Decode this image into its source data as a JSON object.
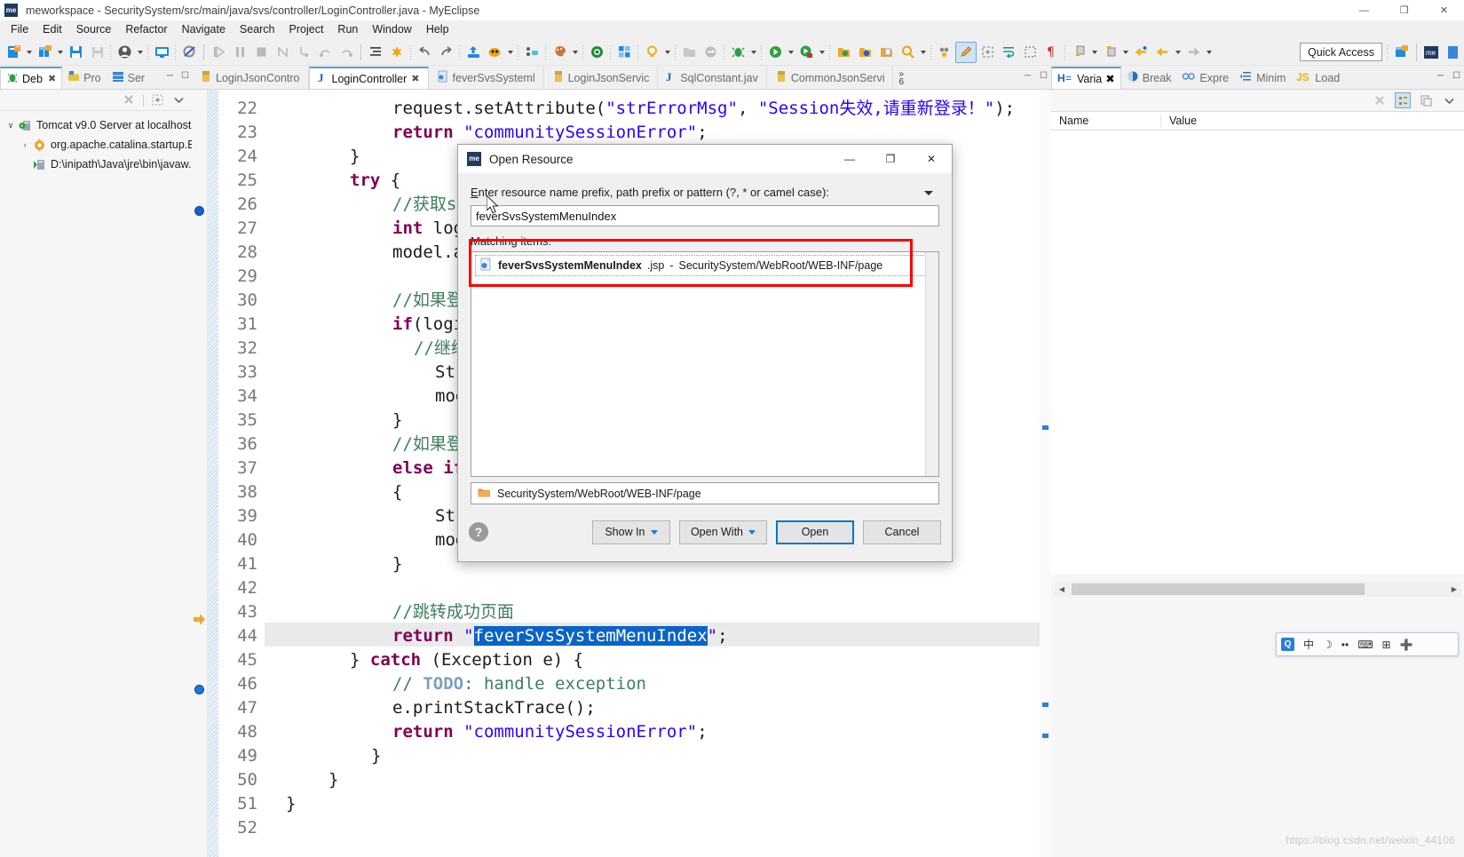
{
  "window": {
    "title": "meworkspace - SecuritySystem/src/main/java/svs/controller/LoginController.java - MyEclipse",
    "app_badge": "me",
    "minimize": "—",
    "maximize": "❐",
    "close": "✕"
  },
  "menubar": {
    "items": [
      "File",
      "Edit",
      "Source",
      "Refactor",
      "Navigate",
      "Search",
      "Project",
      "Run",
      "Window",
      "Help"
    ]
  },
  "toolbar": {
    "quick_access": "Quick Access",
    "icons": [
      "new-file-icon",
      "new-wizard-icon",
      "save-icon",
      "save-all-icon",
      "user-icon",
      "console-icon",
      "skip-breakpoints-icon",
      "resume-icon",
      "suspend-icon",
      "terminate-icon",
      "disconnect-icon",
      "step-into-icon",
      "step-over-icon",
      "step-return-icon",
      "indent-icon",
      "run-last-icon",
      "undo-icon",
      "redo-icon",
      "export-icon",
      "myeclipse-icon",
      "uml-icon",
      "palette-icon",
      "database-icon",
      "perspective-icon",
      "lightbulb-icon",
      "open-folder-icon",
      "refresh-icon",
      "debug-bug-icon",
      "run-icon",
      "run-profile-icon",
      "open-type-icon",
      "open-search-icon",
      "open-resource-icon",
      "search-icon",
      "toggle-markers-icon",
      "edit-pencil-icon",
      "focus-icon",
      "word-wrap-icon",
      "block-select-icon",
      "show-whitespace-icon",
      "next-annotation-icon",
      "prev-annotation-icon",
      "back-icon",
      "forward-icon"
    ]
  },
  "left_panel": {
    "tabs": [
      {
        "label": "Deb",
        "icon": "debug-bug-icon",
        "active": true,
        "closable": true
      },
      {
        "label": "Pro",
        "icon": "project-explorer-icon",
        "active": false,
        "closable": false
      },
      {
        "label": "Ser",
        "icon": "servers-icon",
        "active": false,
        "closable": false
      }
    ],
    "toolbar_icons": [
      "remove-all-terminated-icon",
      "tree-layout-icon",
      "collapse-icon",
      "view-menu-icon"
    ],
    "tree": [
      {
        "indent": 0,
        "twisty": "∨",
        "icon": "server-icon",
        "label": "Tomcat v9.0 Server at localhost"
      },
      {
        "indent": 1,
        "twisty": "›",
        "icon": "thread-icon",
        "label": "org.apache.catalina.startup.Bо"
      },
      {
        "indent": 1,
        "twisty": "",
        "icon": "process-icon",
        "label": "D:\\inipath\\Java\\jre\\bin\\javaw."
      }
    ]
  },
  "editor": {
    "tabs": [
      {
        "label": "LoginJsonContro",
        "icon": "java-file-icon",
        "active": false,
        "closable": false
      },
      {
        "label": "LoginController",
        "icon": "java-active-icon",
        "active": true,
        "closable": true
      },
      {
        "label": "feverSvsSysteml",
        "icon": "jsp-file-icon",
        "active": false,
        "closable": false
      },
      {
        "label": "LoginJsonServic",
        "icon": "java-file-icon",
        "active": false,
        "closable": false
      },
      {
        "label": "SqlConstant.jav",
        "icon": "java-active-icon",
        "active": false,
        "closable": false
      },
      {
        "label": "CommonJsonServi",
        "icon": "java-file-icon",
        "active": false,
        "closable": false
      }
    ],
    "more_tabs": {
      "chevron": "»",
      "count": "6"
    },
    "code_lines": [
      {
        "n": "22",
        "indent": 6,
        "html": "request.setAttribute(<span class=\"s\">\"strErrorMsg\"</span>, <span class=\"s\">\"Session失效,请重新登录！\"</span>);"
      },
      {
        "n": "23",
        "indent": 6,
        "html": "<span class=\"k\">return</span> <span class=\"s\">\"communitySessionError\"</span>;"
      },
      {
        "n": "24",
        "indent": 4,
        "html": "}"
      },
      {
        "n": "25",
        "indent": 4,
        "html": "<span class=\"k\">try</span> {"
      },
      {
        "n": "26",
        "indent": 6,
        "html": "<span class=\"c\">//获取ses</span>"
      },
      {
        "n": "27",
        "indent": 6,
        "html": "<span class=\"k\">int</span> logi"
      },
      {
        "n": "28",
        "indent": 6,
        "html": "model.ad"
      },
      {
        "n": "29",
        "indent": 6,
        "html": ""
      },
      {
        "n": "30",
        "indent": 6,
        "html": "<span class=\"c\">//如果登陆</span>"
      },
      {
        "n": "31",
        "indent": 6,
        "html": "<span class=\"k\">if</span>(login"
      },
      {
        "n": "32",
        "indent": 7,
        "html": "<span class=\"c\">//继续</span>"
      },
      {
        "n": "33",
        "indent": 8,
        "html": "Stri"
      },
      {
        "n": "34",
        "indent": 8,
        "html": "mode"
      },
      {
        "n": "35",
        "indent": 6,
        "html": "}"
      },
      {
        "n": "36",
        "indent": 6,
        "html": "<span class=\"c\">//如果登陆</span>"
      },
      {
        "n": "37",
        "indent": 6,
        "html": "<span class=\"k\">else if</span>("
      },
      {
        "n": "38",
        "indent": 6,
        "html": "{"
      },
      {
        "n": "39",
        "indent": 8,
        "html": "Stri"
      },
      {
        "n": "40",
        "indent": 8,
        "html": "mode"
      },
      {
        "n": "41",
        "indent": 6,
        "html": "}"
      },
      {
        "n": "42",
        "indent": 6,
        "html": ""
      },
      {
        "n": "43",
        "indent": 6,
        "html": "<span class=\"c\">//跳转成功页面</span>"
      },
      {
        "n": "44",
        "indent": 6,
        "html": "<span class=\"k\">return</span> <span class=\"s\">\"</span><span class=\"sel-text\">feverSvsSystemMenuIndex</span><span class=\"s\">\"</span>;"
      },
      {
        "n": "45",
        "indent": 4,
        "html": "} <span class=\"k\">catch</span> (Exception e) {"
      },
      {
        "n": "46",
        "indent": 6,
        "html": "<span class=\"c\">// <span class=\"tdo\">TODO</span>: handle exception</span>"
      },
      {
        "n": "47",
        "indent": 6,
        "html": "e.printStackTrace();"
      },
      {
        "n": "48",
        "indent": 6,
        "html": "<span class=\"k\">return</span> <span class=\"s\">\"communitySessionError\"</span>;"
      },
      {
        "n": "49",
        "indent": 5,
        "html": "}"
      },
      {
        "n": "50",
        "indent": 3,
        "html": "}"
      },
      {
        "n": "51",
        "indent": 1,
        "html": "}"
      },
      {
        "n": "52",
        "indent": 1,
        "html": ""
      }
    ],
    "highlighted_line": "44",
    "breakpoint_lines": [
      "27",
      "46"
    ],
    "current_exec_line": "44"
  },
  "right_panel": {
    "tabs": [
      {
        "label": "Varia",
        "icon": "variables-icon",
        "active": true,
        "closable": true
      },
      {
        "label": "Break",
        "icon": "breakpoints-icon",
        "active": false,
        "closable": false
      },
      {
        "label": "Expre",
        "icon": "expressions-icon",
        "active": false,
        "closable": false
      },
      {
        "label": "Minim",
        "icon": "minimap-icon",
        "active": false,
        "closable": false
      },
      {
        "label": "Load",
        "icon": "js-loaded-scripts-icon",
        "active": false,
        "closable": false
      }
    ],
    "toolbar_icons": [
      "collapse-all-icon",
      "tree-layout-icon",
      "copy-icon",
      "view-menu-icon"
    ],
    "columns": [
      "Name",
      "Value"
    ],
    "rows": []
  },
  "dialog": {
    "title": "Open Resource",
    "badge": "me",
    "minimize": "—",
    "maximize": "❐",
    "close": "✕",
    "prompt_label": "Enter resource name prefix, path prefix or pattern (?, * or camel case):",
    "prompt_mnemonic": "E",
    "input_value": "feverSvsSystemMenuIndex",
    "matching_label": "Matching items:",
    "matches": [
      {
        "name": "feverSvsSystemMenuIndex",
        "ext": ".jsp",
        "separator": " - ",
        "path": "SecuritySystem/WebRoot/WEB-INF/page",
        "icon": "jsp-file-icon"
      }
    ],
    "selected_path": "SecuritySystem/WebRoot/WEB-INF/page",
    "path_icon": "folder-icon",
    "help": "?",
    "buttons": [
      {
        "label": "Show In",
        "has_caret": true,
        "default": false,
        "mnemonic": "w"
      },
      {
        "label": "Open With",
        "has_caret": true,
        "default": false,
        "mnemonic": "h"
      },
      {
        "label": "Open",
        "has_caret": false,
        "default": true,
        "mnemonic": "O"
      },
      {
        "label": "Cancel",
        "has_caret": false,
        "default": false,
        "mnemonic": ""
      }
    ]
  },
  "ime": {
    "logo": "Q",
    "items": [
      "中",
      "☽",
      "••",
      "⌨",
      "⊞",
      "➕"
    ]
  },
  "watermark": "https://blog.csdn.net/weixin_44106",
  "colors": {
    "accent": "#2b7fd4",
    "tab_active_top": "#5c9ccc",
    "selection": "#0a64c8",
    "redbox": "#fc0000",
    "keyword": "#7f0055",
    "string": "#2a00ff",
    "comment": "#3f7f5f"
  }
}
